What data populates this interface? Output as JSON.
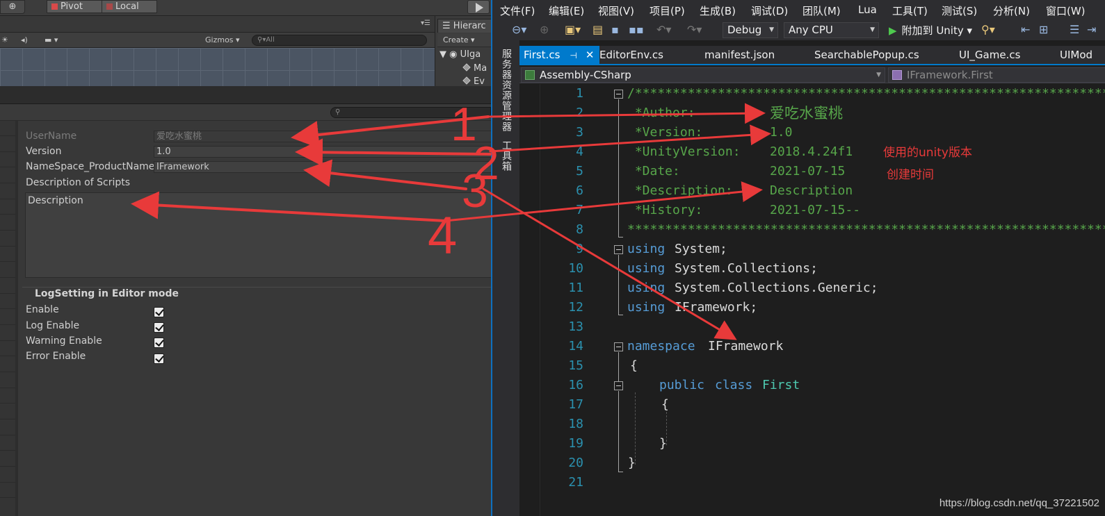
{
  "unity": {
    "toolbar": {
      "pivot": "Pivot",
      "local": "Local"
    },
    "scene": {
      "gizmos": "Gizmos",
      "search_placeholder": "All"
    },
    "hierarchy": {
      "tab": "Hierarc",
      "create": "Create",
      "root": "UIga",
      "rows": [
        "Ma",
        "Ev"
      ]
    },
    "inspector": {
      "fields": [
        {
          "label": "UserName",
          "value": "爱吃水蜜桃"
        },
        {
          "label": "Version",
          "value": "1.0"
        },
        {
          "label": "NameSpace_ProductName",
          "value": "IFramework"
        }
      ],
      "description_label": "Description of Scripts",
      "description_value": "Description",
      "log_section": "LogSetting in Editor mode",
      "log_items": [
        "Enable",
        "Log Enable",
        "Warning Enable",
        "Error Enable"
      ]
    }
  },
  "vs": {
    "menu": [
      "文件(F)",
      "编辑(E)",
      "视图(V)",
      "项目(P)",
      "生成(B)",
      "调试(D)",
      "团队(M)",
      "Lua",
      "工具(T)",
      "测试(S)",
      "分析(N)",
      "窗口(W)"
    ],
    "toolbar": {
      "config": "Debug",
      "platform": "Any CPU",
      "attach": "附加到 Unity"
    },
    "side_panels": [
      "服务器资源管理器",
      "工具箱"
    ],
    "tabs": [
      "First.cs",
      "EditorEnv.cs",
      "manifest.json",
      "SearchablePopup.cs",
      "UI_Game.cs",
      "UIMod"
    ],
    "nav": {
      "project": "Assembly-CSharp",
      "type": "IFramework.First"
    },
    "line_numbers": [
      "1",
      "2",
      "3",
      "4",
      "5",
      "6",
      "7",
      "8",
      "9",
      "10",
      "11",
      "12",
      "13",
      "14",
      "15",
      "16",
      "17",
      "18",
      "19",
      "20",
      "21"
    ],
    "header": {
      "stars": "/*****************************************************************************",
      "author_key": " *Author:",
      "author_val": "爱吃水蜜桃",
      "version_key": " *Version:",
      "version_val": "1.0",
      "unity_key": " *UnityVersion:",
      "unity_val": "2018.4.24f1",
      "date_key": " *Date:",
      "date_val": "2021-07-15",
      "desc_key": " *Description:",
      "desc_val": "Description",
      "history_key": " *History:",
      "history_val": "2021-07-15--",
      "end": "*****************************************************************************"
    },
    "code": {
      "using": "using",
      "u1": "System;",
      "u2": "System.Collections;",
      "u3": "System.Collections.Generic;",
      "u4": "IFramework;",
      "namespace_kw": "namespace",
      "namespace_name": "IFramework",
      "open_brace": "{",
      "close_brace": "}",
      "public_kw": "public",
      "class_kw": "class",
      "class_name": "First"
    }
  },
  "annotations": {
    "numbers": [
      "1",
      "2",
      "3",
      "4"
    ],
    "unity_version_note": "使用的unity版本",
    "date_note": "创建时间",
    "color": "#e83a3a"
  },
  "watermark": "https://blog.csdn.net/qq_37221502"
}
